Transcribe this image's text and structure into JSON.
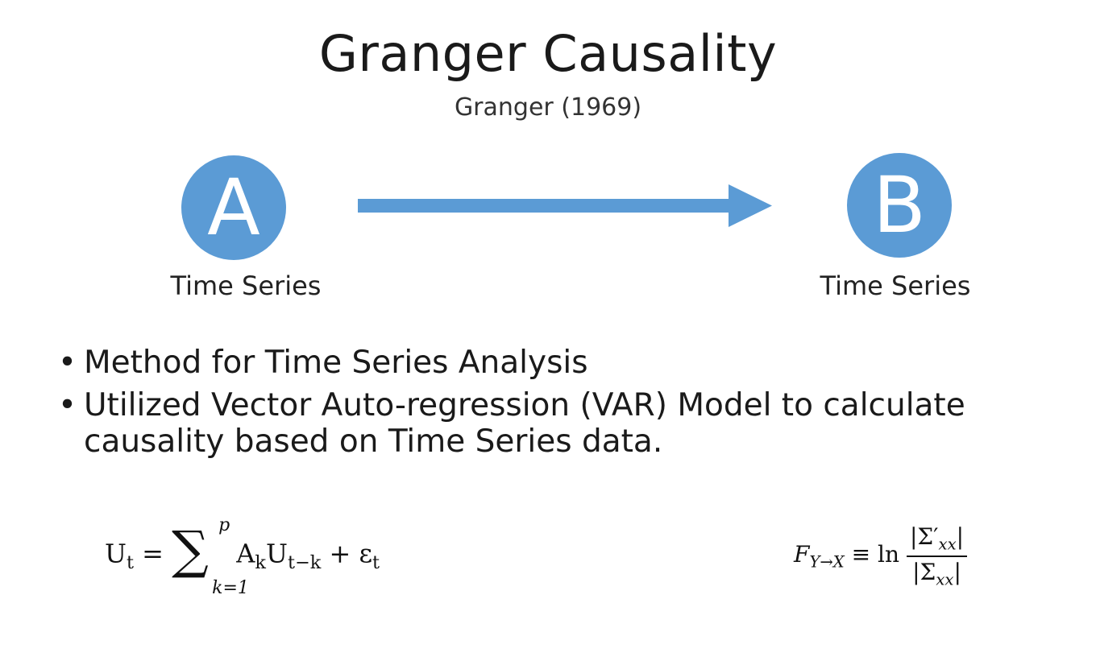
{
  "title": "Granger Causality",
  "subtitle": "Granger (1969)",
  "colors": {
    "node_fill": "#5b9bd5",
    "arrow": "#5b9bd5",
    "node_text": "#ffffff"
  },
  "nodes": [
    {
      "letter": "A",
      "caption": "Time Series"
    },
    {
      "letter": "B",
      "caption": "Time Series"
    }
  ],
  "arrow_icon": "right-arrow-icon",
  "bullets": [
    {
      "marker": "•",
      "text": "Method for Time Series Analysis"
    },
    {
      "marker": "•",
      "text": "Utilized Vector Auto-regression (VAR) Model to calculate causality based on Time Series data."
    }
  ],
  "equations": {
    "var_model": {
      "lhs": "U",
      "lhs_sub": "t",
      "equals": "=",
      "sum_symbol": "∑",
      "sum_upper": "p",
      "sum_lower": "k=1",
      "term1": "A",
      "term1_sub": "k",
      "term2": "U",
      "term2_sub": "t−k",
      "plus": "+",
      "error": "ε",
      "error_sub": "t"
    },
    "granger_measure": {
      "lhs": "F",
      "lhs_sub": "Y→X",
      "equiv": "≡",
      "ln": "ln",
      "numerator": "|Σ′",
      "numerator_sub": "xx",
      "numerator_close": "|",
      "denominator": "|Σ",
      "denominator_sub": "xx",
      "denominator_close": "|"
    }
  }
}
